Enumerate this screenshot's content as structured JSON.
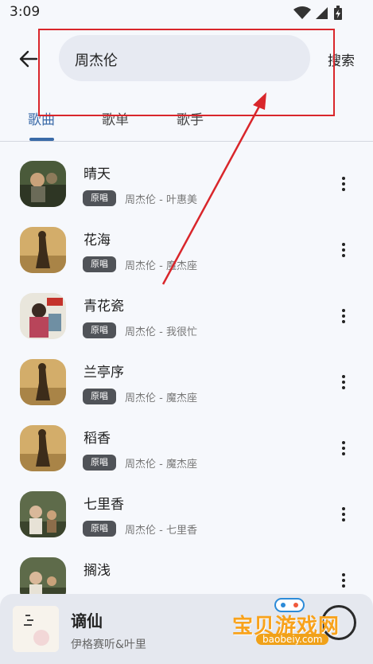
{
  "status": {
    "time": "3:09"
  },
  "search": {
    "value": "周杰伦",
    "button": "搜索"
  },
  "tabs": [
    {
      "label": "歌曲",
      "active": true
    },
    {
      "label": "歌单",
      "active": false
    },
    {
      "label": "歌手",
      "active": false
    }
  ],
  "songs": [
    {
      "title": "晴天",
      "badge": "原唱",
      "meta": "周杰伦 - 叶惠美"
    },
    {
      "title": "花海",
      "badge": "原唱",
      "meta": "周杰伦 - 魔杰座"
    },
    {
      "title": "青花瓷",
      "badge": "原唱",
      "meta": "周杰伦 - 我很忙"
    },
    {
      "title": "兰亭序",
      "badge": "原唱",
      "meta": "周杰伦 - 魔杰座"
    },
    {
      "title": "稻香",
      "badge": "原唱",
      "meta": "周杰伦 - 魔杰座"
    },
    {
      "title": "七里香",
      "badge": "原唱",
      "meta": "周杰伦 - 七里香"
    },
    {
      "title": "搁浅",
      "badge": "",
      "meta": ""
    }
  ],
  "player": {
    "title": "谪仙",
    "artist": "伊格赛听&叶里"
  },
  "watermark": {
    "text": "宝贝游戏网",
    "url": "baobeiy.com"
  },
  "colors": {
    "accent": "#3a6aa8",
    "annotation": "#d9262b",
    "watermark": "#f8a21b"
  },
  "icons": {
    "back": "arrow-left-icon",
    "more": "more-vert-icon",
    "wifi": "wifi-icon",
    "battery": "battery-icon"
  }
}
